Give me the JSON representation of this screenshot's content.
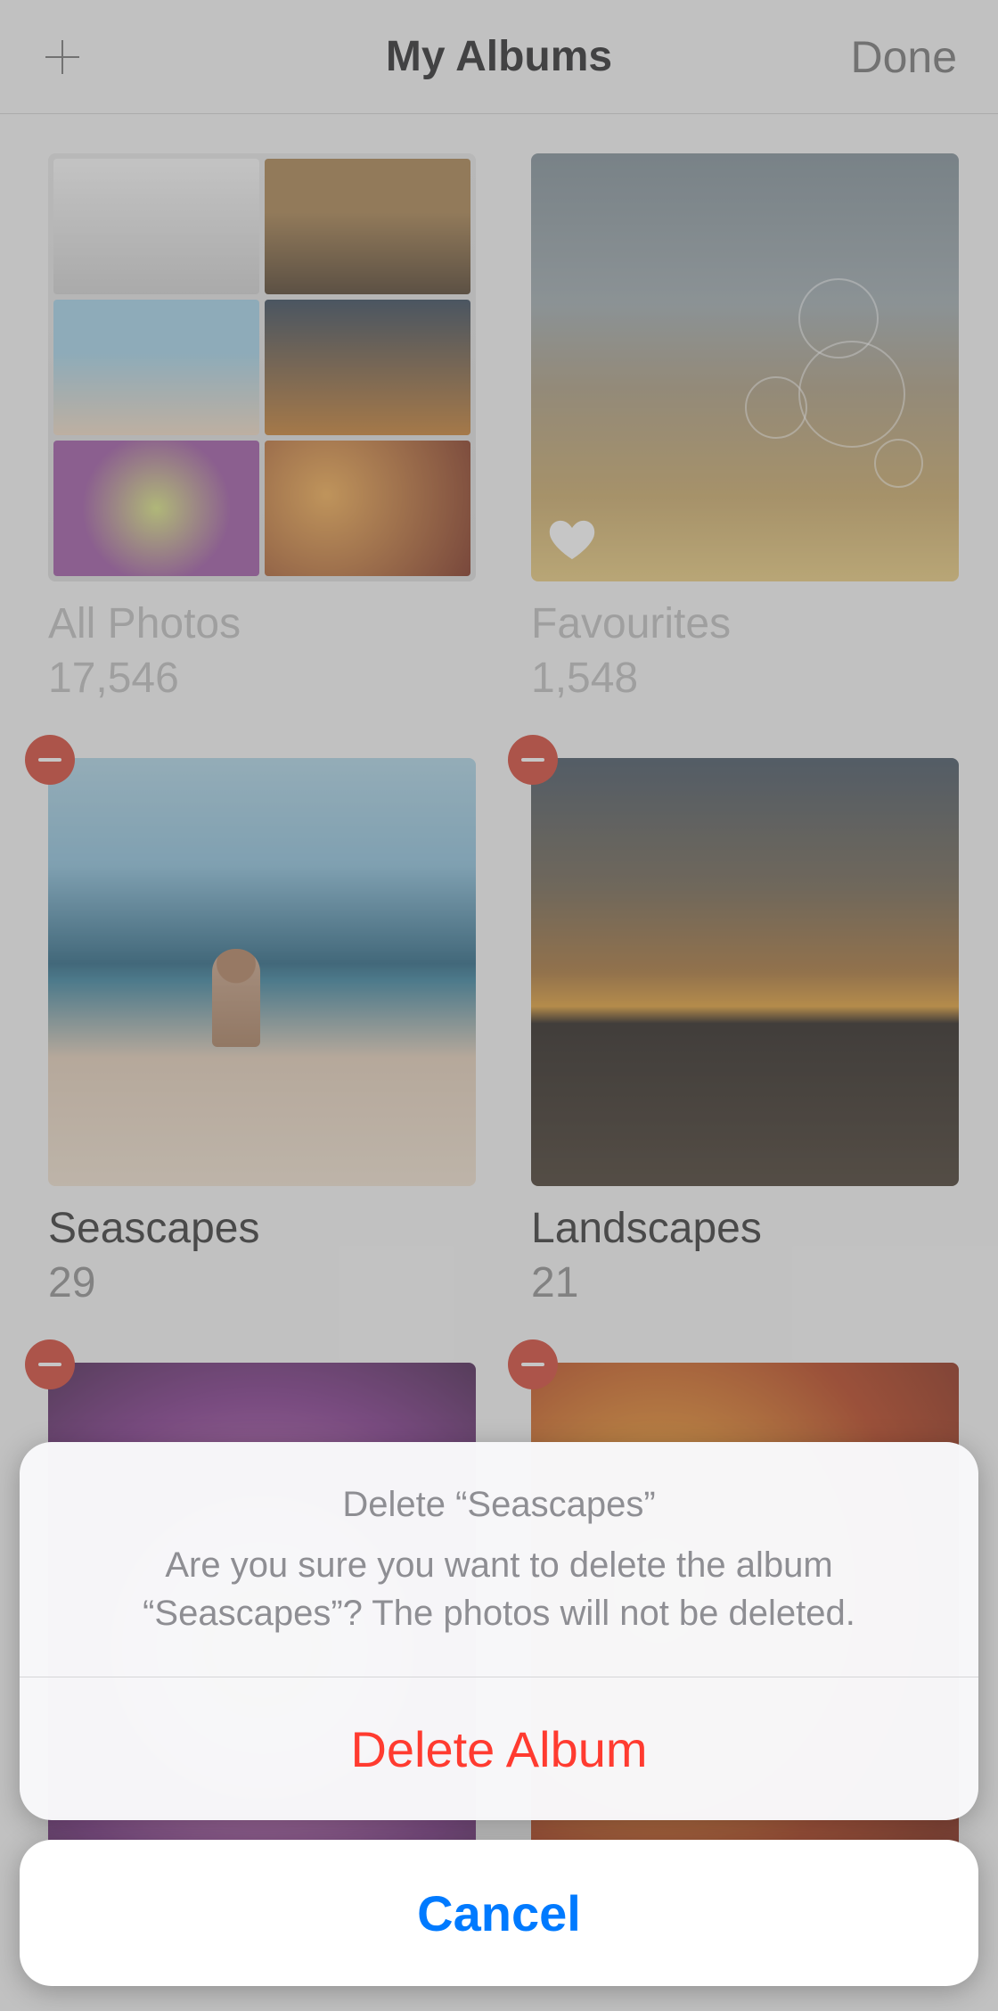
{
  "header": {
    "title": "My Albums",
    "done_label": "Done"
  },
  "albums": [
    {
      "name": "All Photos",
      "count": "17,546",
      "deletable": false,
      "thumb": "allphotos",
      "favourite_badge": false
    },
    {
      "name": "Favourites",
      "count": "1,548",
      "deletable": false,
      "thumb": "favourites",
      "favourite_badge": true
    },
    {
      "name": "Seascapes",
      "count": "29",
      "deletable": true,
      "thumb": "seascapes",
      "favourite_badge": false
    },
    {
      "name": "Landscapes",
      "count": "21",
      "deletable": true,
      "thumb": "landscapes",
      "favourite_badge": false
    },
    {
      "name": "",
      "count": "",
      "deletable": true,
      "thumb": "flower",
      "favourite_badge": false
    },
    {
      "name": "",
      "count": "",
      "deletable": true,
      "thumb": "bloom",
      "favourite_badge": false
    }
  ],
  "sheet": {
    "title": "Delete “Seascapes”",
    "message": "Are you sure you want to delete the album “Seascapes”? The photos will not be deleted.",
    "destructive_label": "Delete Album",
    "cancel_label": "Cancel"
  }
}
